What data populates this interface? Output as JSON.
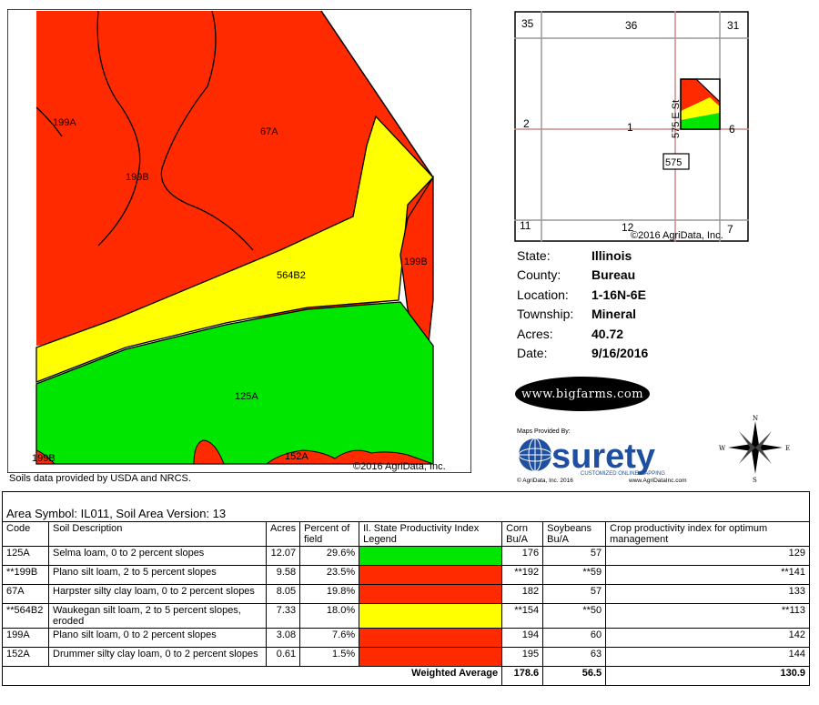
{
  "soil_map": {
    "labels": [
      "199A",
      "67A",
      "199B",
      "564B2",
      "199B",
      "125A",
      "199B",
      "152A"
    ],
    "copyright": "©2016 AgriData, Inc.",
    "credit": "Soils data provided by USDA and NRCS.",
    "colors": {
      "red": "#ff2a00",
      "yellow": "#ffff00",
      "green": "#00e600"
    }
  },
  "locator": {
    "sections": [
      "35",
      "36",
      "31",
      "2",
      "1",
      "6",
      "11",
      "12",
      "7"
    ],
    "road_label": "575 E St",
    "route_shield": "575",
    "copyright": "©2016 AgriData, Inc."
  },
  "info": [
    {
      "label": "State:",
      "value": "Illinois"
    },
    {
      "label": "County:",
      "value": "Bureau"
    },
    {
      "label": "Location:",
      "value": "1-16N-6E"
    },
    {
      "label": "Township:",
      "value": "Mineral"
    },
    {
      "label": "Acres:",
      "value": "40.72"
    },
    {
      "label": "Date:",
      "value": "9/16/2016"
    }
  ],
  "logos": {
    "bigfarms": "www.bigfarms.com",
    "surety_top": "Maps Provided By:",
    "surety_word": "surety",
    "surety_sub": "CUSTOMIZED ONLINE MAPPING",
    "surety_left": "© AgriData, Inc. 2016",
    "surety_right": "www.AgriDataInc.com",
    "compass": {
      "n": "N",
      "s": "S",
      "e": "E",
      "w": "W"
    }
  },
  "table": {
    "caption": "Area Symbol: IL011, Soil Area Version: 13",
    "headers": [
      "Code",
      "Soil Description",
      "Acres",
      "Percent of field",
      "Il. State Productivity Index Legend",
      "Corn Bu/A",
      "Soybeans Bu/A",
      "Crop productivity index for optimum management"
    ],
    "rows": [
      {
        "code": "125A",
        "desc": "Selma loam, 0 to 2 percent slopes",
        "acres": "12.07",
        "pct": "29.6%",
        "color": "#00e600",
        "corn": "176",
        "soy": "57",
        "cpi": "129"
      },
      {
        "code": "**199B",
        "desc": "Plano silt loam, 2 to 5 percent slopes",
        "acres": "9.58",
        "pct": "23.5%",
        "color": "#ff2a00",
        "corn": "**192",
        "soy": "**59",
        "cpi": "**141"
      },
      {
        "code": "67A",
        "desc": "Harpster silty clay loam, 0 to 2 percent slopes",
        "acres": "8.05",
        "pct": "19.8%",
        "color": "#ff2a00",
        "corn": "182",
        "soy": "57",
        "cpi": "133"
      },
      {
        "code": "**564B2",
        "desc": "Waukegan silt loam, 2 to 5 percent slopes, eroded",
        "acres": "7.33",
        "pct": "18.0%",
        "color": "#ffff00",
        "corn": "**154",
        "soy": "**50",
        "cpi": "**113"
      },
      {
        "code": "199A",
        "desc": "Plano silt loam, 0 to 2 percent slopes",
        "acres": "3.08",
        "pct": "7.6%",
        "color": "#ff2a00",
        "corn": "194",
        "soy": "60",
        "cpi": "142"
      },
      {
        "code": "152A",
        "desc": "Drummer silty clay loam, 0 to 2 percent slopes",
        "acres": "0.61",
        "pct": "1.5%",
        "color": "#ff2a00",
        "corn": "195",
        "soy": "63",
        "cpi": "144"
      }
    ],
    "weighted": {
      "label": "Weighted Average",
      "corn": "178.6",
      "soy": "56.5",
      "cpi": "130.9"
    }
  }
}
